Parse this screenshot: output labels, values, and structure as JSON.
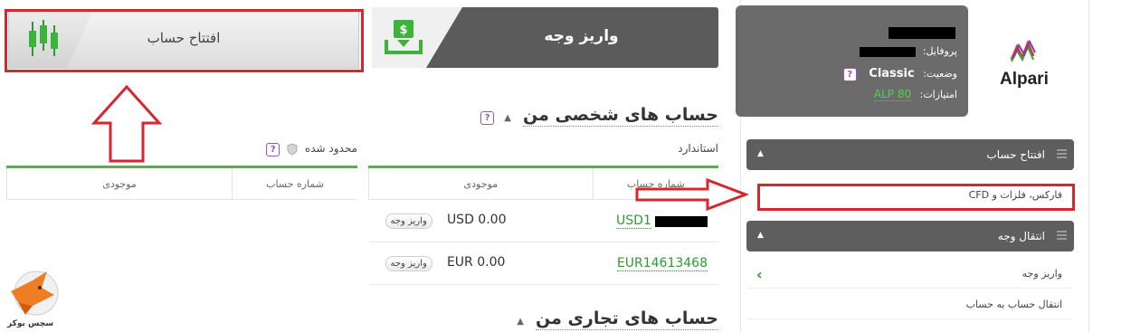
{
  "top_buttons": {
    "open_account": "افتتاح حساب",
    "deposit": "واریز وجه"
  },
  "personal_accounts": {
    "title": "حساب های شخصی من",
    "help": "?",
    "collapse": "▲",
    "standard": {
      "label": "استاندارد",
      "headers": {
        "account_no": "شماره حساب",
        "balance": "موجودی"
      },
      "rows": [
        {
          "account": "USD1",
          "amount": "USD 0.00",
          "deposit": "واریز وجه"
        },
        {
          "account": "EUR14613468",
          "amount": "EUR 0.00",
          "deposit": "واریز وجه"
        }
      ]
    },
    "restricted": {
      "label": "محدود شده",
      "headers": {
        "account_no": "شماره حساب",
        "balance": "موجودی"
      }
    }
  },
  "trading_accounts": {
    "title": "حساب های تجاری من",
    "collapse": "▲"
  },
  "sidebar": {
    "logo_text": "Alpari",
    "profile": {
      "profile_label": "پروفایل:",
      "status_label": "وضعیت:",
      "status_value": "Classic",
      "points_label": "امتیازات:",
      "points_value": "ALP 80",
      "help": "?"
    },
    "menu": [
      {
        "title": "افتتاح حساب",
        "items": [
          "فارکس، فلزات و CFD"
        ]
      },
      {
        "title": "انتقال وجه",
        "items": [
          "واریز وجه",
          "انتقال حساب به حساب"
        ]
      }
    ],
    "active_marker": "›"
  },
  "watermark": {
    "text": "سچس بوکر"
  },
  "colors": {
    "accent_green": "#4bb54b",
    "annotation_red": "#d7262c",
    "help_purple": "#9b4fc7"
  }
}
